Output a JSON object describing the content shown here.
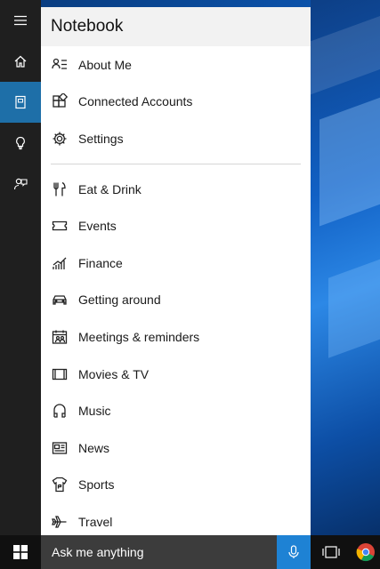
{
  "panel": {
    "title": "Notebook"
  },
  "rail": {
    "items": [
      {
        "icon": "hamburger-icon"
      },
      {
        "icon": "home-icon"
      },
      {
        "icon": "notebook-icon",
        "active": true
      },
      {
        "icon": "lightbulb-icon"
      },
      {
        "icon": "feedback-icon"
      }
    ]
  },
  "settings_items": [
    {
      "label": "About Me",
      "icon": "about-me-icon"
    },
    {
      "label": "Connected Accounts",
      "icon": "connected-accounts-icon"
    },
    {
      "label": "Settings",
      "icon": "gear-icon"
    }
  ],
  "notebook_items": [
    {
      "label": "Eat & Drink",
      "icon": "fork-knife-icon"
    },
    {
      "label": "Events",
      "icon": "ticket-icon"
    },
    {
      "label": "Finance",
      "icon": "finance-chart-icon"
    },
    {
      "label": "Getting around",
      "icon": "car-icon"
    },
    {
      "label": "Meetings & reminders",
      "icon": "calendar-people-icon"
    },
    {
      "label": "Movies & TV",
      "icon": "film-icon"
    },
    {
      "label": "Music",
      "icon": "music-note-icon"
    },
    {
      "label": "News",
      "icon": "newspaper-icon"
    },
    {
      "label": "Sports",
      "icon": "jersey-icon"
    },
    {
      "label": "Travel",
      "icon": "airplane-icon"
    }
  ],
  "taskbar": {
    "search_placeholder": "Ask me anything"
  },
  "colors": {
    "accent": "#1e6fa8",
    "mic": "#1e82d4",
    "rail": "#1f1f1f",
    "taskbar": "#101010"
  }
}
